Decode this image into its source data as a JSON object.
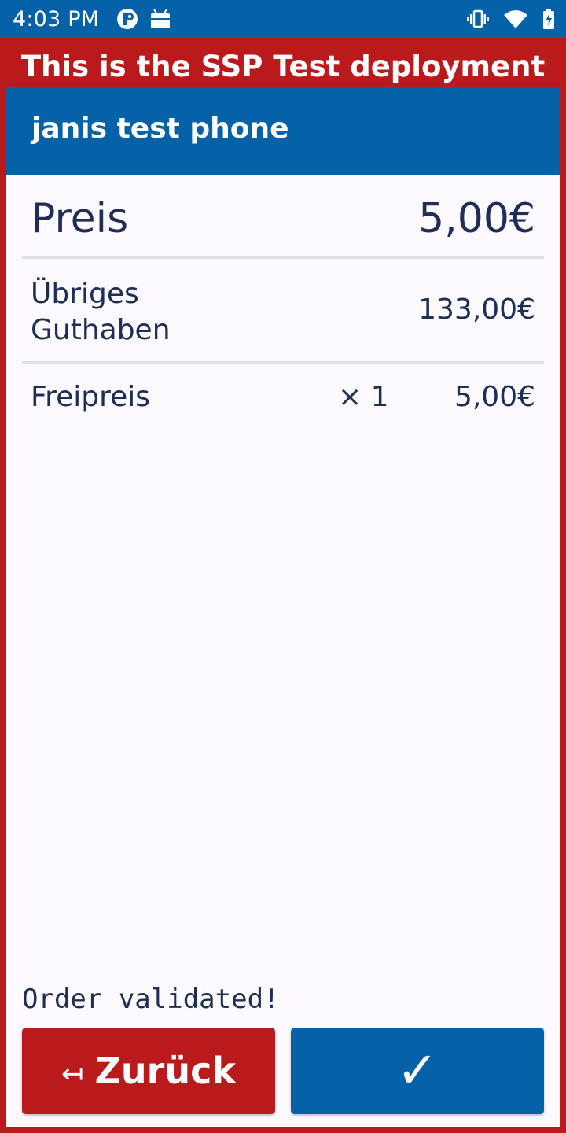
{
  "status_bar": {
    "time": "4:03 PM",
    "left_icons": [
      "app-notification-icon",
      "android-debug-icon"
    ],
    "right_icons": [
      "vibrate-icon",
      "wifi-icon",
      "battery-charging-icon"
    ]
  },
  "banner": {
    "text": "This is the SSP Test deployment"
  },
  "header": {
    "title": "janis test phone"
  },
  "summary": {
    "price_label": "Preis",
    "price_value": "5,00€",
    "balance_label": "Übriges Guthaben",
    "balance_value": "133,00€"
  },
  "items": [
    {
      "name": "Freipreis",
      "quantity": "× 1",
      "price": "5,00€"
    }
  ],
  "status_message": "Order validated!",
  "buttons": {
    "back_arrow": "↤",
    "back_label": "Zurück",
    "confirm_label": "✓"
  },
  "colors": {
    "primary_blue": "#0561a8",
    "alert_red": "#bb1a1d",
    "text_navy": "#1e2e56",
    "background": "#fcfaff"
  }
}
